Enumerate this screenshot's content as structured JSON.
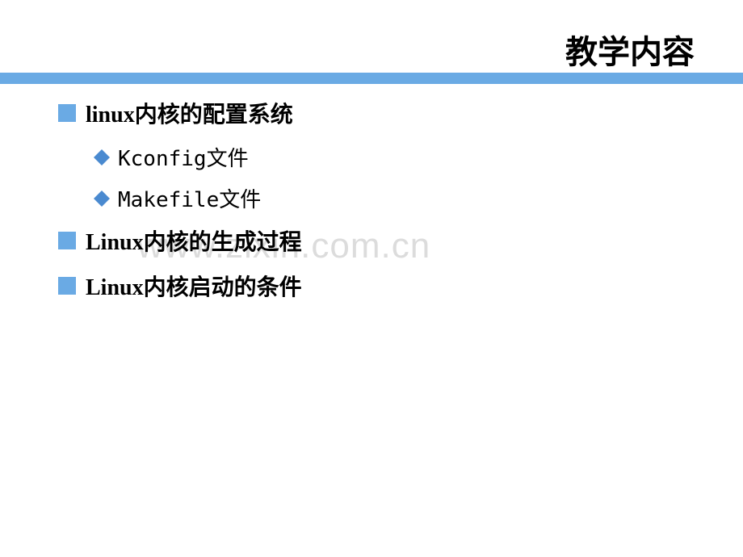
{
  "title": "教学内容",
  "watermark": "www.zixin.com.cn",
  "items": [
    {
      "text": "linux内核的配置系统",
      "subs": [
        {
          "text": "Kconfig文件"
        },
        {
          "text": "Makefile文件"
        }
      ]
    },
    {
      "text": "Linux内核的生成过程",
      "subs": []
    },
    {
      "text": "Linux内核启动的条件",
      "subs": []
    }
  ]
}
